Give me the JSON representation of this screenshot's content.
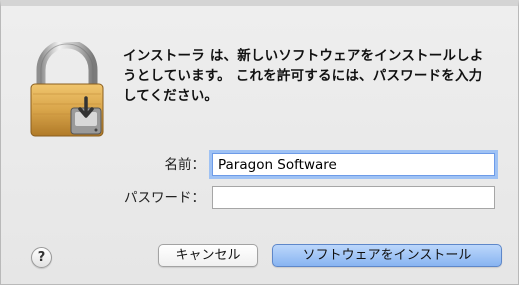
{
  "dialog": {
    "message": "インストーラ は、新しいソフトウェアをインストールしようとしています。 これを許可するには、パスワードを入力してください。",
    "name_label": "名前：",
    "name_value": "Paragon Software",
    "password_label": "パスワード：",
    "password_value": "",
    "help_label": "?",
    "cancel_label": "キャンセル",
    "install_label": "ソフトウェアをインストール"
  },
  "icons": {
    "lock": "lock-icon",
    "disk": "hard-disk-icon"
  },
  "colors": {
    "lock_body": "#d9a54a",
    "shackle": "#c9c9c9",
    "focus_ring": "#9fc2f4",
    "default_button": "#88b4f1"
  }
}
